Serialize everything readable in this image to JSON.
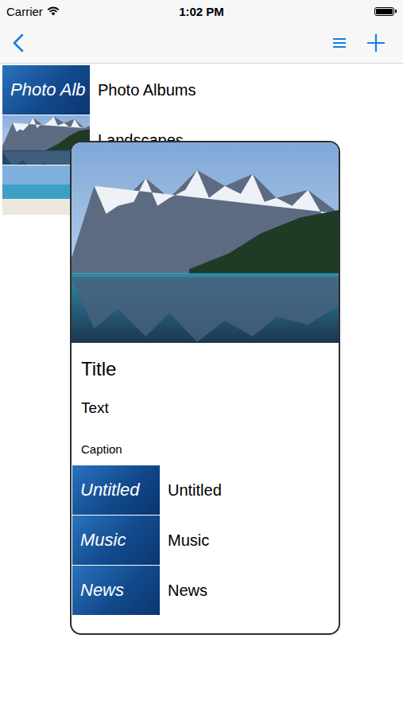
{
  "status_bar": {
    "carrier": "Carrier",
    "time": "1:02 PM"
  },
  "list": {
    "rows": [
      {
        "title": "Photo Albums",
        "kind": "tile",
        "thumb_text": "Photo Alb"
      },
      {
        "title": "Landscapes",
        "kind": "mountain"
      },
      {
        "kind": "beach"
      }
    ]
  },
  "preview": {
    "kind": "mountain",
    "title": "Title",
    "text": "Text",
    "caption": "Caption",
    "rows": [
      {
        "title": "Untitled",
        "kind": "tile",
        "thumb_text": "Untitled"
      },
      {
        "title": "Music",
        "kind": "tile",
        "thumb_text": "Music"
      },
      {
        "title": "News",
        "kind": "tile",
        "thumb_text": "News"
      }
    ]
  }
}
